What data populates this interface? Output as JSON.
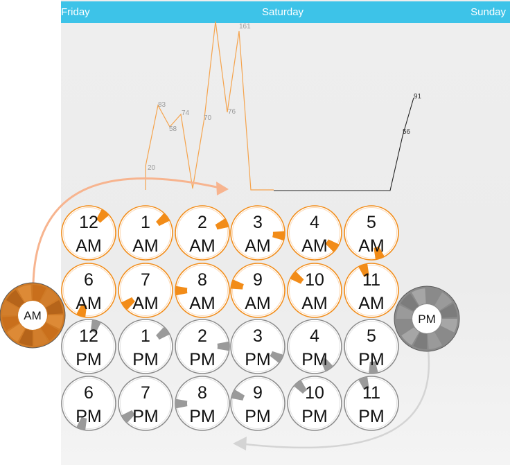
{
  "header": {
    "prev_day": "Friday",
    "current_day": "Saturday",
    "next_day": "Sunday",
    "bg_color": "#3dc3e8"
  },
  "chart_data": {
    "type": "line",
    "series": [
      {
        "color": "#f5a34c",
        "points": [
          {
            "label": "20"
          },
          {
            "label": "83"
          },
          {
            "label": "58"
          },
          {
            "label": "74"
          },
          {
            "label": "70"
          },
          {
            "label": "76"
          },
          {
            "label": "161"
          }
        ]
      },
      {
        "color": "#222222",
        "points": [
          {
            "label": "56"
          },
          {
            "label": "91"
          }
        ]
      }
    ]
  },
  "am_dial": {
    "label": "AM",
    "color": "#cf7a26"
  },
  "pm_dial": {
    "label": "PM",
    "color": "#8a8a8a"
  },
  "hours": [
    {
      "hour": "12",
      "period": "AM",
      "fraction": 0.08
    },
    {
      "hour": "1",
      "period": "AM",
      "fraction": 0.12
    },
    {
      "hour": "2",
      "period": "AM",
      "fraction": 0.16
    },
    {
      "hour": "3",
      "period": "AM",
      "fraction": 0.24
    },
    {
      "hour": "4",
      "period": "AM",
      "fraction": 0.32
    },
    {
      "hour": "5",
      "period": "AM",
      "fraction": 0.42
    },
    {
      "hour": "6",
      "period": "AM",
      "fraction": 0.52
    },
    {
      "hour": "7",
      "period": "AM",
      "fraction": 0.62
    },
    {
      "hour": "8",
      "period": "AM",
      "fraction": 0.72
    },
    {
      "hour": "9",
      "period": "AM",
      "fraction": 0.76
    },
    {
      "hour": "10",
      "period": "AM",
      "fraction": 0.82
    },
    {
      "hour": "11",
      "period": "AM",
      "fraction": 0.92
    },
    {
      "hour": "12",
      "period": "PM",
      "fraction": 0.02
    },
    {
      "hour": "1",
      "period": "PM",
      "fraction": 0.12
    },
    {
      "hour": "2",
      "period": "PM",
      "fraction": 0.22
    },
    {
      "hour": "3",
      "period": "PM",
      "fraction": 0.3
    },
    {
      "hour": "4",
      "period": "PM",
      "fraction": 0.38
    },
    {
      "hour": "5",
      "period": "PM",
      "fraction": 0.46
    },
    {
      "hour": "6",
      "period": "PM",
      "fraction": 0.52
    },
    {
      "hour": "7",
      "period": "PM",
      "fraction": 0.62
    },
    {
      "hour": "8",
      "period": "PM",
      "fraction": 0.72
    },
    {
      "hour": "9",
      "period": "PM",
      "fraction": 0.78
    },
    {
      "hour": "10",
      "period": "PM",
      "fraction": 0.86
    },
    {
      "hour": "11",
      "period": "PM",
      "fraction": 0.92
    }
  ]
}
